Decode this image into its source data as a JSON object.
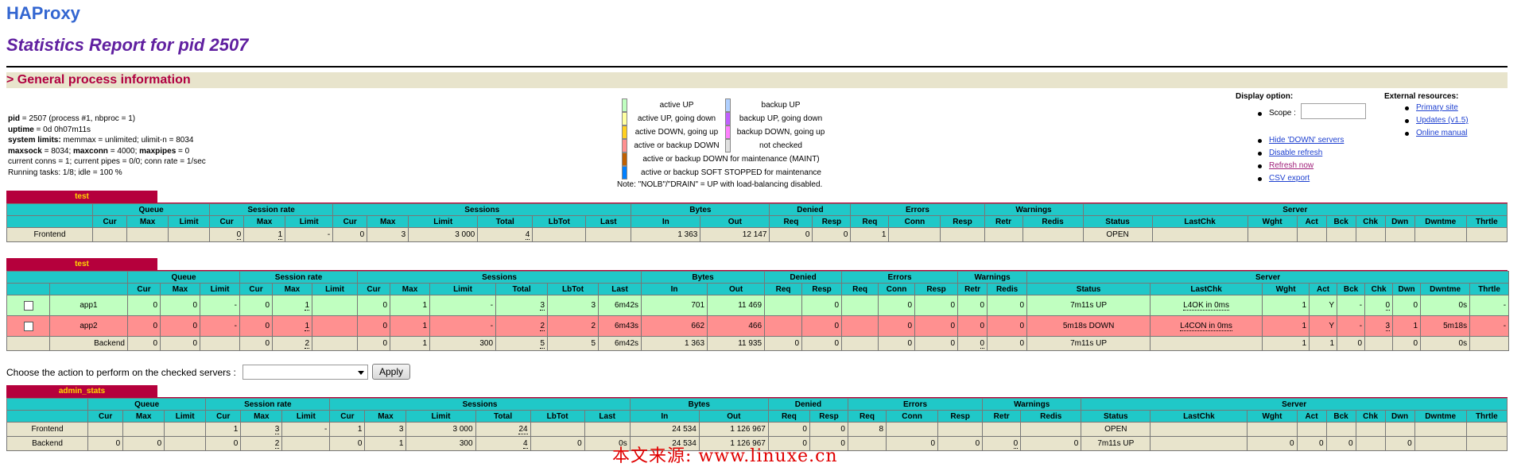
{
  "header": {
    "app_title": "HAProxy",
    "report_title": "Statistics Report for pid 2507",
    "section_title": "> General process information"
  },
  "process_info": [
    {
      "label": "pid",
      "value": " = 2507 (process #1, nbproc = 1)"
    },
    {
      "label": "uptime",
      "value": " = 0d 0h07m11s"
    },
    {
      "label": "system limits:",
      "value": " memmax = unlimited; ulimit-n = 8034"
    },
    {
      "label": "maxsock",
      "value": " = 8034; "
    },
    {
      "label": "",
      "value": "current conns = 1; current pipes = 0/0; conn rate = 1/sec"
    },
    {
      "label": "",
      "value": "Running tasks: 1/8; idle = 100 %"
    }
  ],
  "process_info_maxline": {
    "maxconn_label": "maxconn",
    "maxconn_value": " = 4000; ",
    "maxpipes_label": "maxpipes",
    "maxpipes_value": " = 0"
  },
  "legend": {
    "items": [
      {
        "color": "#c0ffc0",
        "label": "active UP"
      },
      {
        "color": "#ffffa0",
        "label": "active UP, going down"
      },
      {
        "color": "#ffd020",
        "label": "active DOWN, going up"
      },
      {
        "color": "#ff9090",
        "label": "active or backup DOWN"
      },
      {
        "color": "#c06000",
        "label": "active or backup DOWN for maintenance (MAINT)"
      },
      {
        "color": "#0080ff",
        "label": "active or backup SOFT STOPPED for maintenance"
      }
    ],
    "backup_items": [
      {
        "color": "#b0d0ff",
        "label": "backup UP"
      },
      {
        "color": "#c060ff",
        "label": "backup UP, going down"
      },
      {
        "color": "#ff80ff",
        "label": "backup DOWN, going up"
      },
      {
        "color": "#e0e0e0",
        "label": "not checked"
      }
    ],
    "note": "Note: \"NOLB\"/\"DRAIN\" = UP with load-balancing disabled."
  },
  "display_option": {
    "title": "Display option:",
    "scope_label": "Scope :",
    "scope_value": "",
    "links": [
      "Hide 'DOWN' servers",
      "Disable refresh",
      "Refresh now",
      "CSV export"
    ]
  },
  "external_resources": {
    "title": "External resources:",
    "links": [
      "Primary site",
      "Updates (v1.5)",
      "Online manual"
    ]
  },
  "columns": {
    "groups": [
      "Queue",
      "Session rate",
      "Sessions",
      "Bytes",
      "Denied",
      "Errors",
      "Warnings",
      "Server"
    ],
    "sub": [
      "Cur",
      "Max",
      "Limit",
      "Cur",
      "Max",
      "Limit",
      "Cur",
      "Max",
      "Limit",
      "Total",
      "LbTot",
      "Last",
      "In",
      "Out",
      "Req",
      "Resp",
      "Req",
      "Conn",
      "Resp",
      "Retr",
      "Redis",
      "Status",
      "LastChk",
      "Wght",
      "Act",
      "Bck",
      "Chk",
      "Dwn",
      "Dwntme",
      "Thrtle"
    ]
  },
  "proxies": [
    {
      "name": "test",
      "rows": [
        {
          "kind": "front",
          "name": "Frontend",
          "cells": [
            "",
            "",
            "",
            "0",
            "1",
            "-",
            "0",
            "3",
            "3 000",
            "4",
            "",
            "",
            "1 363",
            "12 147",
            "0",
            "0",
            "1",
            "",
            "",
            "",
            "",
            "OPEN",
            "",
            "",
            "",
            "",
            "",
            "",
            "",
            ""
          ]
        }
      ]
    },
    {
      "name": "test",
      "rows": [
        {
          "kind": "up",
          "name": "app1",
          "cells": [
            "0",
            "0",
            "-",
            "0",
            "1",
            "",
            "0",
            "1",
            "-",
            "3",
            "3",
            "6m42s",
            "701",
            "11 469",
            "",
            "0",
            "",
            "0",
            "0",
            "0",
            "0",
            "7m11s UP",
            "L4OK in 0ms",
            "1",
            "Y",
            "-",
            "0",
            "0",
            "0s",
            "-"
          ]
        },
        {
          "kind": "down",
          "name": "app2",
          "cells": [
            "0",
            "0",
            "-",
            "0",
            "1",
            "",
            "0",
            "1",
            "-",
            "2",
            "2",
            "6m43s",
            "662",
            "466",
            "",
            "0",
            "",
            "0",
            "0",
            "0",
            "0",
            "5m18s DOWN",
            "L4CON in 0ms",
            "1",
            "Y",
            "-",
            "3",
            "1",
            "5m18s",
            "-"
          ]
        },
        {
          "kind": "back",
          "name": "Backend",
          "cells": [
            "0",
            "0",
            "",
            "0",
            "2",
            "",
            "0",
            "1",
            "300",
            "5",
            "5",
            "6m42s",
            "1 363",
            "11 935",
            "0",
            "0",
            "",
            "0",
            "0",
            "0",
            "0",
            "7m11s UP",
            "",
            "1",
            "1",
            "0",
            "",
            "0",
            "0s",
            ""
          ]
        }
      ]
    },
    {
      "name": "admin_stats",
      "rows": [
        {
          "kind": "front",
          "name": "Frontend",
          "cells": [
            "",
            "",
            "",
            "1",
            "3",
            "-",
            "1",
            "3",
            "3 000",
            "24",
            "",
            "",
            "24 534",
            "1 126 967",
            "0",
            "0",
            "8",
            "",
            "",
            "",
            "",
            "OPEN",
            "",
            "",
            "",
            "",
            "",
            "",
            "",
            ""
          ]
        },
        {
          "kind": "back",
          "name": "Backend",
          "cells": [
            "0",
            "0",
            "",
            "0",
            "2",
            "",
            "0",
            "1",
            "300",
            "4",
            "0",
            "0s",
            "24 534",
            "1 126 967",
            "0",
            "0",
            "",
            "0",
            "0",
            "0",
            "0",
            "7m11s UP",
            "",
            "0",
            "0",
            "0",
            "",
            "0",
            "",
            ""
          ]
        }
      ]
    }
  ],
  "actions": {
    "label": "Choose the action to perform on the checked servers :",
    "selected": "",
    "apply_label": "Apply"
  },
  "watermark": "本文来源: www.linuxe.cn"
}
